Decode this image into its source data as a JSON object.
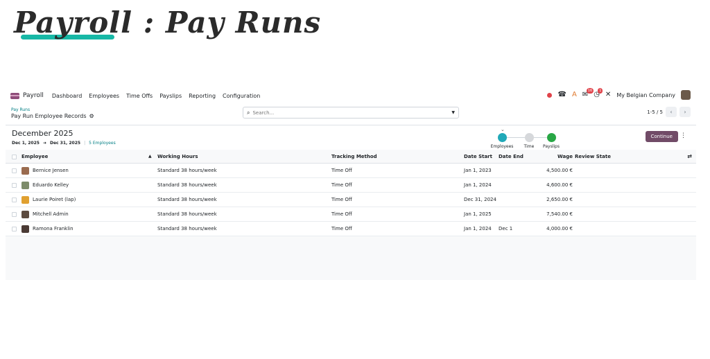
{
  "hero": {
    "title": "Payroll : Pay Runs"
  },
  "navbar": {
    "app_name": "Payroll",
    "items": [
      "Dashboard",
      "Employees",
      "Time Offs",
      "Payslips",
      "Reporting",
      "Configuration"
    ],
    "messages_badge": "16",
    "activity_badge": "1",
    "company": "My Belgian Company"
  },
  "control_panel": {
    "breadcrumb": "Pay Runs",
    "title": "Pay Run Employee Records",
    "search_placeholder": "Search...",
    "pager": "1-5 / 5"
  },
  "pay_run": {
    "title": "December 2025",
    "date_from": "Dec 1, 2025",
    "date_to": "Dec 31, 2025",
    "employee_count": "5 Employees",
    "steps": [
      {
        "label": "Employees",
        "color": "#21a9b8"
      },
      {
        "label": "Time",
        "color": "#d6d8db"
      },
      {
        "label": "Payslips",
        "color": "#28a745"
      }
    ],
    "continue_label": "Continue"
  },
  "table": {
    "headers": {
      "employee": "Employee",
      "working_hours": "Working Hours",
      "tracking_method": "Tracking Method",
      "date_start": "Date Start",
      "date_end": "Date End",
      "wage": "Wage",
      "review_state": "Review State"
    },
    "rows": [
      {
        "employee": "Bernice Jensen",
        "avatar_color": "#9a6b4f",
        "working_hours": "Standard 38 hours/week",
        "tracking_method": "Time Off",
        "date_start": "Jan 1, 2023",
        "date_end": "",
        "wage": "4,500.00 €",
        "review_state": ""
      },
      {
        "employee": "Eduardo Kelley",
        "avatar_color": "#7d8c6a",
        "working_hours": "Standard 38 hours/week",
        "tracking_method": "Time Off",
        "date_start": "Jan 1, 2024",
        "date_end": "",
        "wage": "4,600.00 €",
        "review_state": ""
      },
      {
        "employee": "Laurie Poiret (lap)",
        "avatar_color": "#e0a030",
        "working_hours": "Standard 38 hours/week",
        "tracking_method": "Time Off",
        "date_start": "Dec 31, 2024",
        "date_end": "",
        "wage": "2,650.00 €",
        "review_state": ""
      },
      {
        "employee": "Mitchell Admin",
        "avatar_color": "#5c4a3e",
        "working_hours": "Standard 38 hours/week",
        "tracking_method": "Time Off",
        "date_start": "Jan 1, 2025",
        "date_end": "",
        "wage": "7,540.00 €",
        "review_state": ""
      },
      {
        "employee": "Ramona Franklin",
        "avatar_color": "#4a3a34",
        "working_hours": "Standard 38 hours/week",
        "tracking_method": "Time Off",
        "date_start": "Jan 1, 2024",
        "date_end": "Dec 1",
        "wage": "4,000.00 €",
        "review_state": ""
      }
    ]
  }
}
